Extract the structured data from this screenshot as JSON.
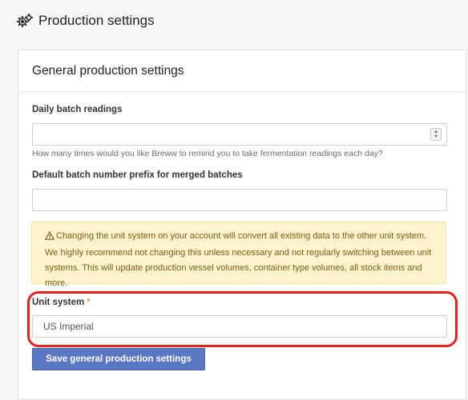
{
  "header": {
    "title": "Production settings",
    "icon": "gears-icon"
  },
  "card": {
    "title": "General production settings"
  },
  "daily_readings": {
    "label": "Daily batch readings",
    "value": "",
    "help": "How many times would you like Breww to remind you to take fermentation readings each day?"
  },
  "batch_prefix": {
    "label": "Default batch number prefix for merged batches",
    "value": ""
  },
  "warning": {
    "icon": "warning-icon",
    "text": "Changing the unit system on your account will convert all existing data to the other unit system. We highly recommend not changing this unless necessary and not regularly switching between unit systems. This will update production vessel volumes, container type volumes, all stock items and more."
  },
  "unit_system": {
    "label": "Unit system",
    "required_mark": "*",
    "value": "US Imperial"
  },
  "save_button": {
    "label": "Save general production settings"
  },
  "colors": {
    "button": "#5a77c4",
    "warning_bg": "#fef3cd",
    "highlight": "#e32222"
  }
}
